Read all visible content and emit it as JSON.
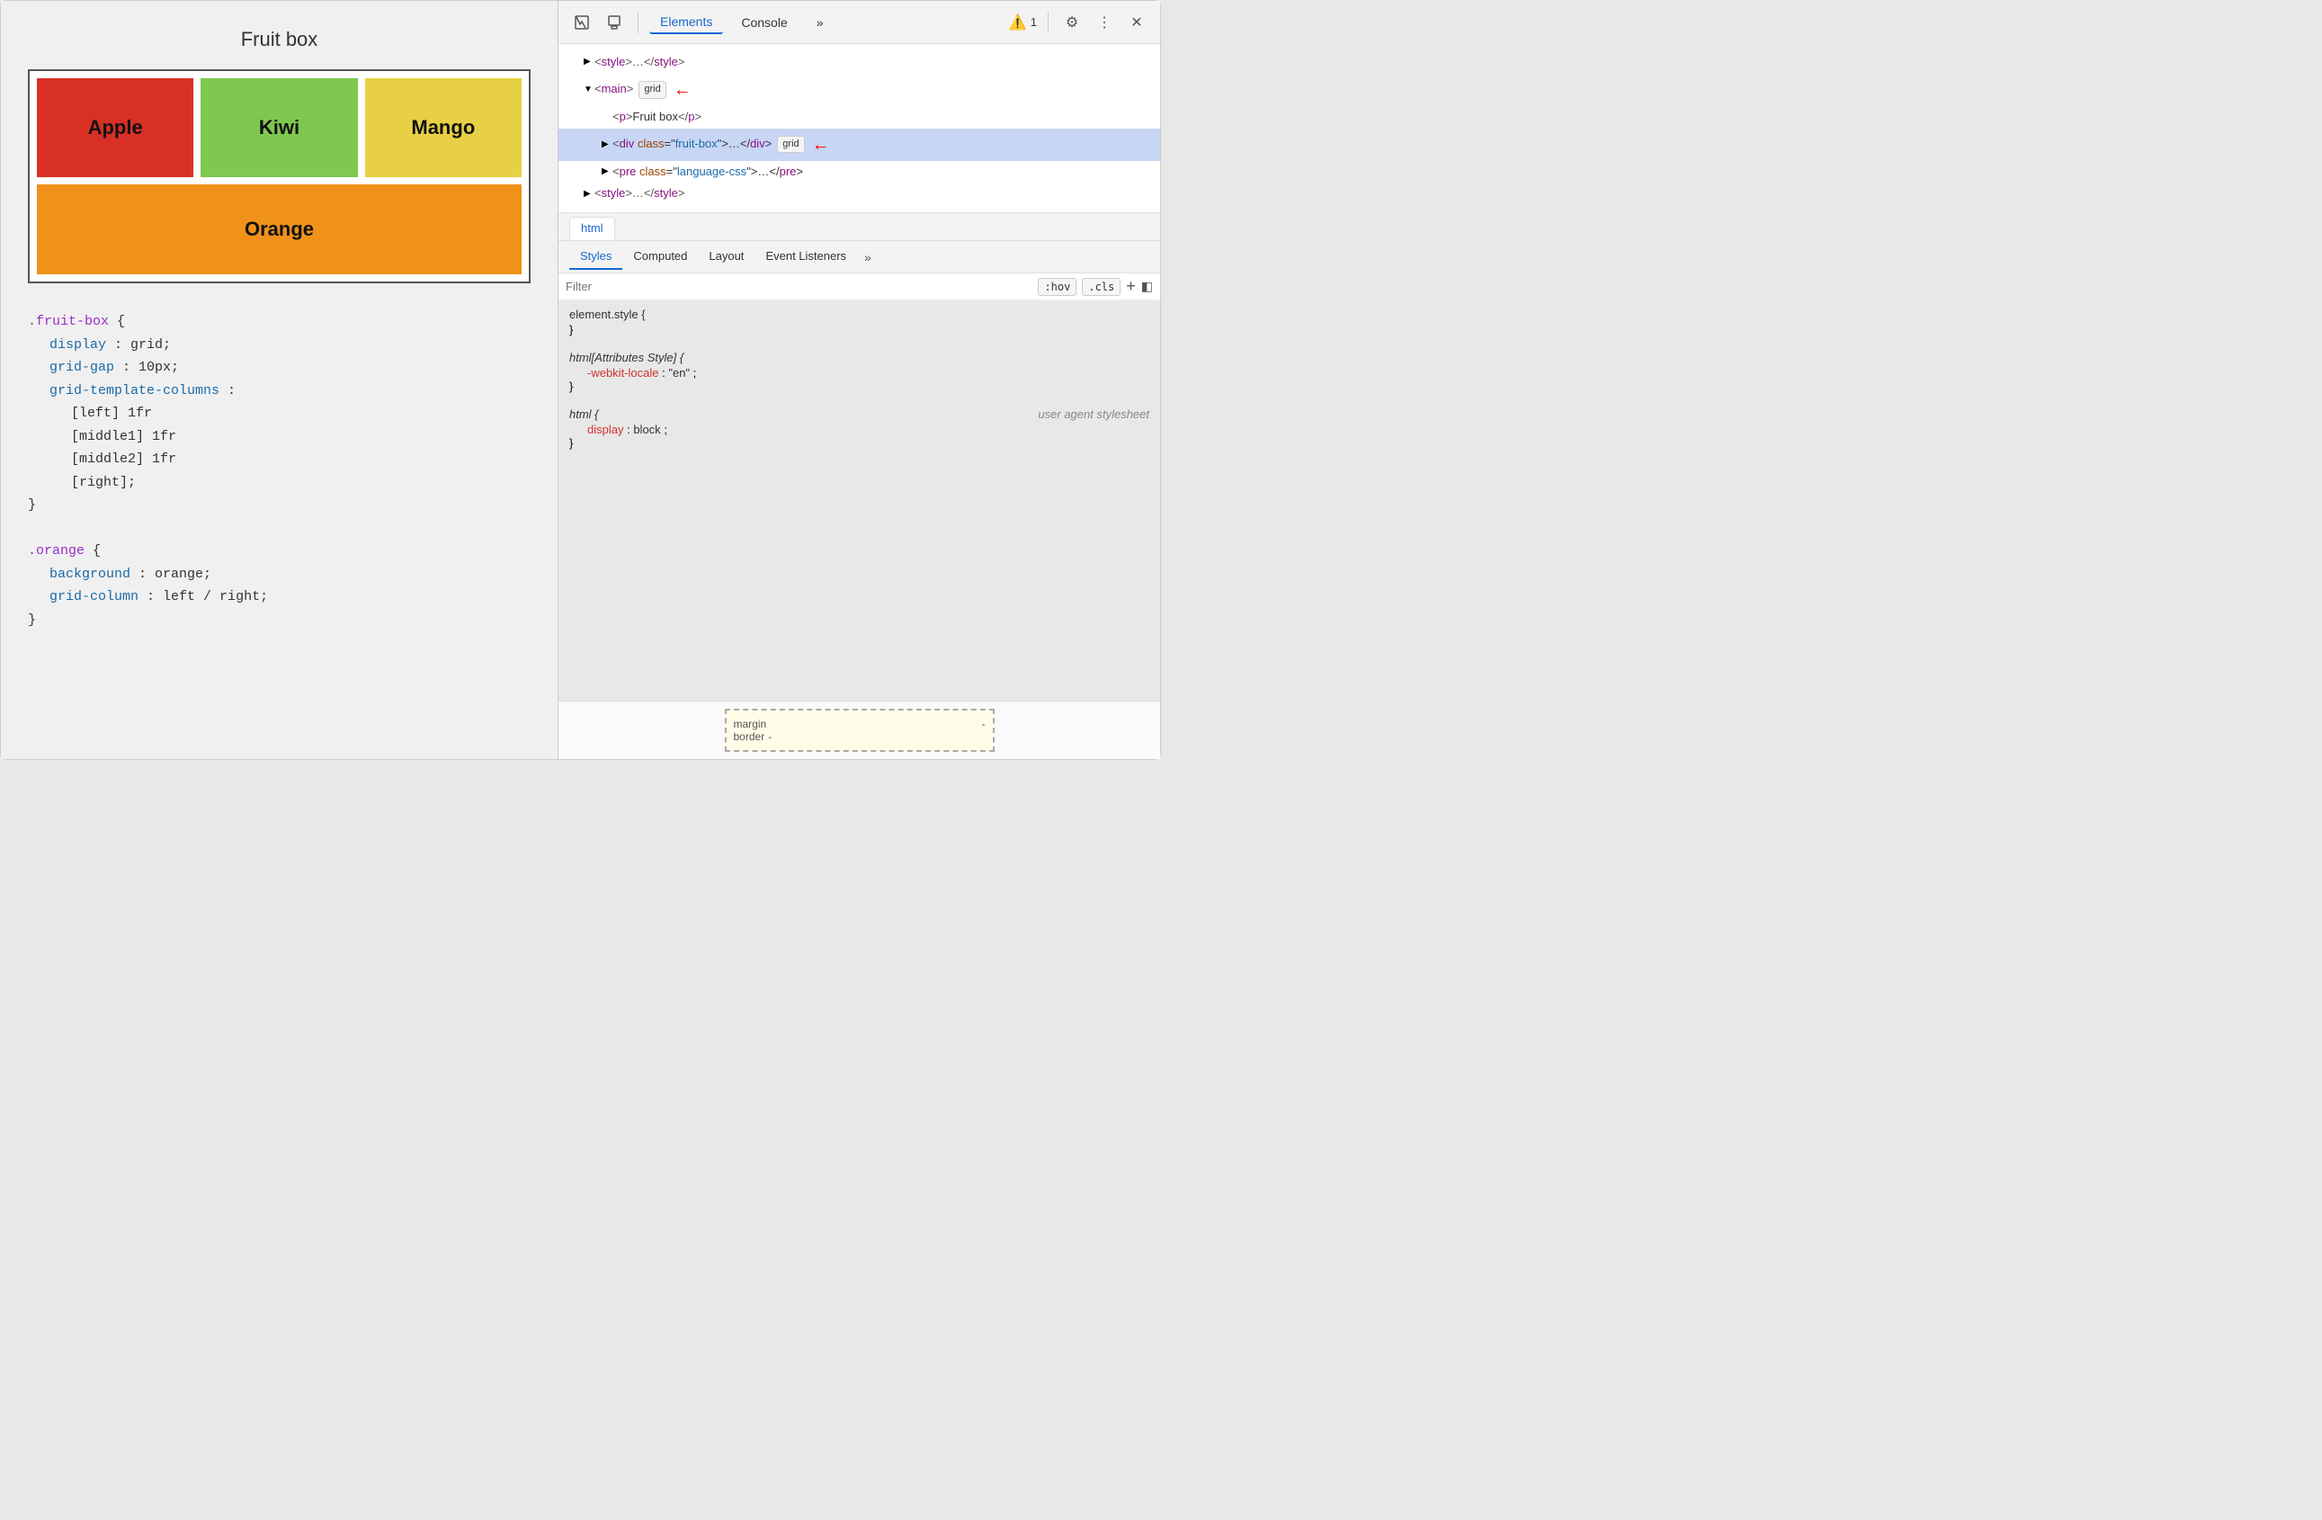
{
  "left": {
    "title": "Fruit box",
    "fruits": [
      {
        "name": "Apple",
        "class": "fruit-apple"
      },
      {
        "name": "Kiwi",
        "class": "fruit-kiwi"
      },
      {
        "name": "Mango",
        "class": "fruit-mango"
      },
      {
        "name": "Orange",
        "class": "fruit-orange"
      }
    ],
    "code": {
      "block1": {
        "selector": ".fruit-box {",
        "lines": [
          {
            "prop": "display",
            "value": ": grid;"
          },
          {
            "prop": "grid-gap",
            "value": ": 10px;"
          },
          {
            "prop": "grid-template-columns",
            "value": ":"
          },
          {
            "val1": "[left] 1fr"
          },
          {
            "val2": "[middle1] 1fr"
          },
          {
            "val3": "[middle2] 1fr"
          },
          {
            "val4": "[right];"
          }
        ],
        "close": "}"
      },
      "block2": {
        "selector": ".orange {",
        "lines": [
          {
            "prop": "background",
            "value": ": orange;"
          },
          {
            "prop": "grid-column",
            "value": ": left / right;"
          }
        ],
        "close": "}"
      }
    }
  },
  "devtools": {
    "toolbar": {
      "tabs": [
        "Elements",
        "Console"
      ],
      "active_tab": "Elements",
      "warning_count": "1",
      "more_label": "»"
    },
    "tree": {
      "lines": [
        {
          "indent": 0,
          "arrow": "▶",
          "content": "<style>…</style>"
        },
        {
          "indent": 0,
          "arrow": "▼",
          "content": "<main>",
          "badge": "grid",
          "arrow_icon": true
        },
        {
          "indent": 1,
          "arrow": " ",
          "content": "<p>Fruit box</p>"
        },
        {
          "indent": 1,
          "arrow": "▶",
          "content": "<div class=\"fruit-box\">…</div>",
          "badge": "grid",
          "selected": true,
          "arrow_icon": true
        },
        {
          "indent": 1,
          "arrow": "▶",
          "content": "<pre class=\"language-css\">…</pre>"
        },
        {
          "indent": 0,
          "arrow": "▶",
          "content": "<style>…</style>"
        }
      ]
    },
    "html_tab": "html",
    "styles_tabs": [
      "Styles",
      "Computed",
      "Layout",
      "Event Listeners"
    ],
    "active_styles_tab": "Styles",
    "filter_placeholder": "Filter",
    "filter_buttons": [
      ":hov",
      ".cls"
    ],
    "styles": {
      "rule1": {
        "selector": "element.style {",
        "close": "}",
        "properties": []
      },
      "rule2": {
        "selector": "html[Attributes Style] {",
        "close": "}",
        "properties": [
          {
            "name": "-webkit-locale",
            "value": "\"en\""
          }
        ]
      },
      "rule3": {
        "selector": "html {",
        "comment": "user agent stylesheet",
        "close": "}",
        "properties": [
          {
            "name": "display",
            "value": "block"
          }
        ]
      }
    },
    "box_model": {
      "margin_label": "margin",
      "margin_value": "-",
      "border_label": "border",
      "border_value": "-"
    }
  }
}
